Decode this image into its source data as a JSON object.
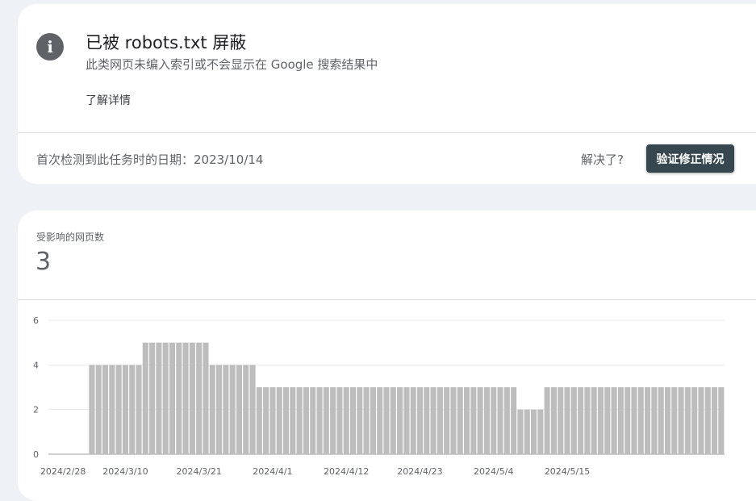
{
  "issue": {
    "icon": "info-icon",
    "title": "已被 robots.txt 屏蔽",
    "description": "此类网页未编入索引或不会显示在 Google 搜索结果中",
    "learn_more": "了解详情",
    "first_detected": "首次检测到此任务时的日期：2023/10/14",
    "resolved_question": "解决了?",
    "validate_button": "验证修正情况"
  },
  "metric": {
    "label": "受影响的网页数",
    "value": "3"
  },
  "colors": {
    "bar": "#bdbdbd",
    "button": "#37474f",
    "background": "#eef2f7"
  },
  "chart_data": {
    "type": "bar",
    "ylim": [
      0,
      6
    ],
    "y_ticks": [
      0,
      2,
      4,
      6
    ],
    "grid": true,
    "x_tick_labels": [
      "2024/2/28",
      "2024/3/10",
      "2024/3/21",
      "2024/4/1",
      "2024/4/12",
      "2024/4/23",
      "2024/5/4",
      "2024/5/15"
    ],
    "start_date": "2024/2/28",
    "values": [
      0,
      0,
      0,
      0,
      0,
      0,
      4,
      4,
      4,
      4,
      4,
      4,
      4,
      4,
      5,
      5,
      5,
      5,
      5,
      5,
      5,
      5,
      5,
      5,
      4,
      4,
      4,
      4,
      4,
      4,
      4,
      3,
      3,
      3,
      3,
      3,
      3,
      3,
      3,
      3,
      3,
      3,
      3,
      3,
      3,
      3,
      3,
      3,
      3,
      3,
      3,
      3,
      3,
      3,
      3,
      3,
      3,
      3,
      3,
      3,
      3,
      3,
      3,
      3,
      3,
      3,
      3,
      3,
      3,
      3,
      2,
      2,
      2,
      2,
      3,
      3,
      3,
      3,
      3,
      3,
      3,
      3,
      3,
      3,
      3,
      3,
      3,
      3,
      3,
      3,
      3,
      3,
      3,
      3,
      3,
      3,
      3,
      3,
      3,
      3,
      3
    ]
  }
}
